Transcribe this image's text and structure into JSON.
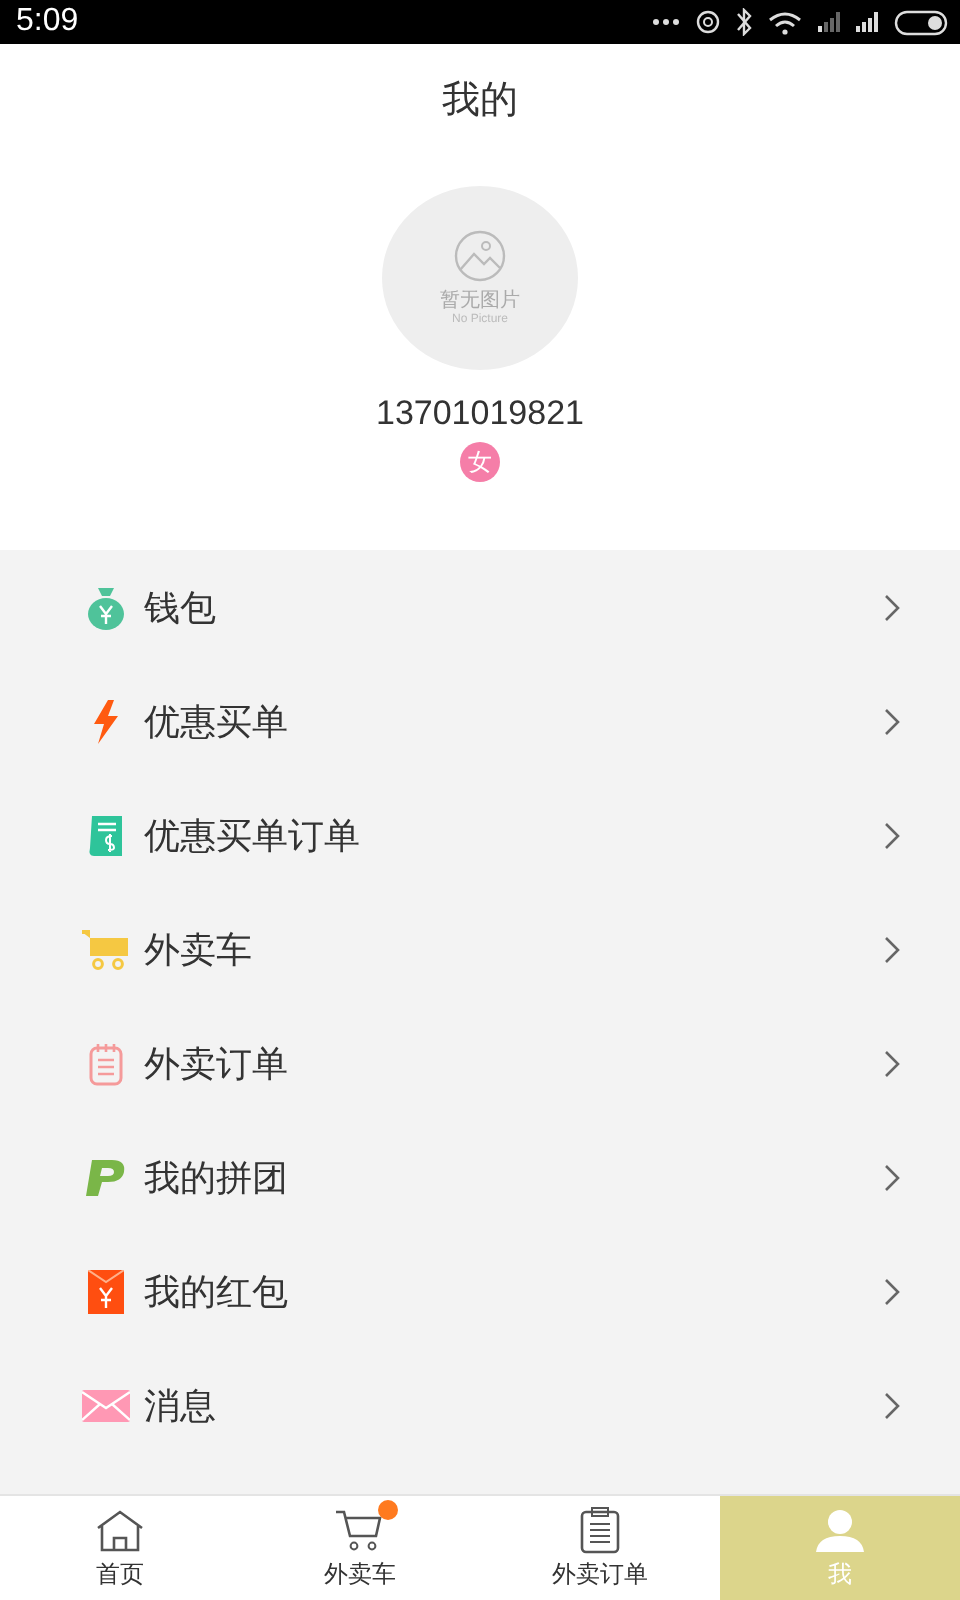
{
  "status_bar": {
    "time": "5:09"
  },
  "header": {
    "title": "我的"
  },
  "profile": {
    "avatar_caption": "暂无图片",
    "avatar_caption_en": "No Picture",
    "phone": "13701019821",
    "gender": "女"
  },
  "menu": [
    {
      "kind": "wallet",
      "label": "钱包"
    },
    {
      "kind": "bolt",
      "label": "优惠买单"
    },
    {
      "kind": "receipt",
      "label": "优惠买单订单"
    },
    {
      "kind": "cart",
      "label": "外卖车"
    },
    {
      "kind": "notepad",
      "label": "外卖订单"
    },
    {
      "kind": "group",
      "label": "我的拼团"
    },
    {
      "kind": "redpacket",
      "label": "我的红包"
    },
    {
      "kind": "mail",
      "label": "消息"
    }
  ],
  "tabbar": [
    {
      "kind": "home",
      "label": "首页",
      "selected": false,
      "badge": false
    },
    {
      "kind": "cart",
      "label": "外卖车",
      "selected": false,
      "badge": true
    },
    {
      "kind": "orders",
      "label": "外卖订单",
      "selected": false,
      "badge": false
    },
    {
      "kind": "me",
      "label": "我",
      "selected": true,
      "badge": false
    }
  ]
}
